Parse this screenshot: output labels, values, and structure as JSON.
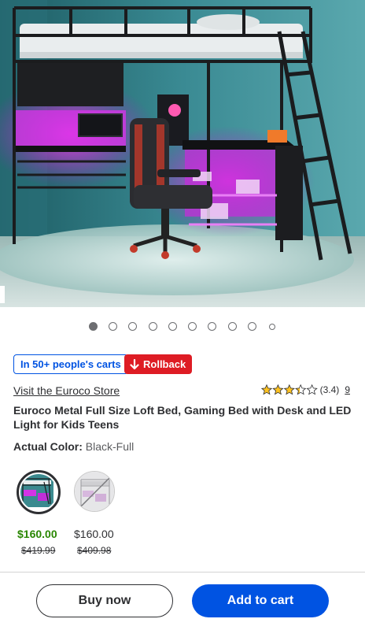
{
  "carousel": {
    "total": 10,
    "active_index": 0
  },
  "badges": {
    "carts_text": "In 50+ people's carts",
    "rollback_text": "Rollback",
    "rollback_icon": "arrow-down-icon"
  },
  "store": {
    "link_text": "Visit the Euroco Store"
  },
  "rating": {
    "stars": 3.4,
    "score_text": "(3.4)",
    "review_count": "9"
  },
  "product": {
    "title": "Euroco Metal Full Size Loft Bed, Gaming Bed with Desk and LED Light for Kids Teens",
    "color_label": "Actual Color:",
    "color_value": "Black-Full"
  },
  "variants": [
    {
      "price": "$160.00",
      "was_price": "$419.99",
      "selected": true,
      "available": true
    },
    {
      "price": "$160.00",
      "was_price": "$409.98",
      "selected": false,
      "available": false
    }
  ],
  "actions": {
    "buy_now": "Buy now",
    "add_to_cart": "Add to cart"
  },
  "colors": {
    "brand_blue": "#0053e2",
    "rollback_red": "#de1c24",
    "price_green": "#2a8703",
    "star": "#ffc220"
  }
}
